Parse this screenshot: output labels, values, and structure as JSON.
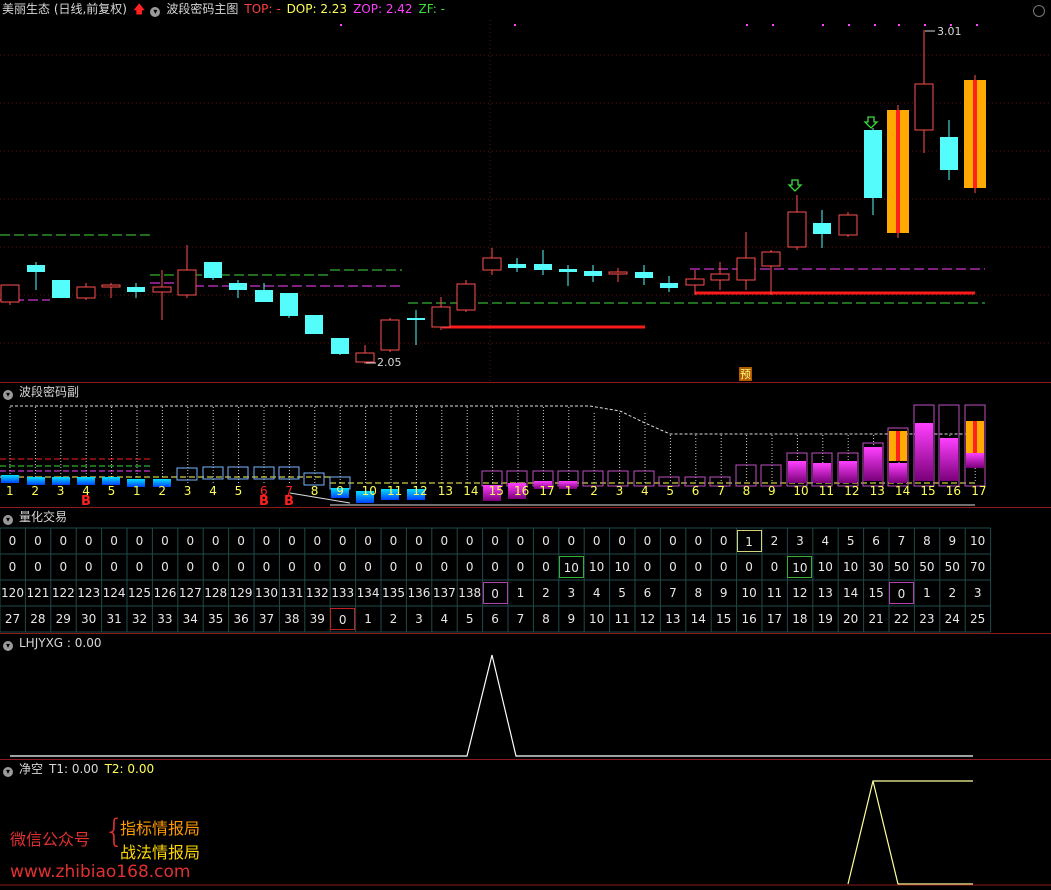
{
  "main": {
    "stock": "美丽生态 (日线,前复权)",
    "indicator": "波段密码主图",
    "top_label": "TOP: -",
    "dop_label": "DOP: 2.23",
    "zop_label": "ZOP: 2.42",
    "zf_label": "ZF: -",
    "high_label": "3.01",
    "low_label": "2.05",
    "yu_badge": "预",
    "colors": {
      "up": "#ff5050",
      "down": "#54fcfc",
      "pink": "#ff40ff",
      "green": "#3cdc3c"
    }
  },
  "sub1": {
    "title": "波段密码副",
    "count_labels": [
      "1",
      "2",
      "3",
      "4",
      "5",
      "1",
      "2",
      "3",
      "4",
      "5",
      "6",
      "7",
      "8",
      "9",
      "10",
      "11",
      "12",
      "13",
      "14",
      "15",
      "16",
      "17",
      "1",
      "2",
      "3",
      "4",
      "5",
      "6",
      "7",
      "8",
      "9",
      "10",
      "11",
      "12",
      "13",
      "14",
      "15",
      "16",
      "17"
    ],
    "b_markers": [
      "B",
      "B",
      "B"
    ]
  },
  "quant": {
    "title": "量化交易",
    "rows": [
      [
        "0",
        "0",
        "0",
        "0",
        "0",
        "0",
        "0",
        "0",
        "0",
        "0",
        "0",
        "0",
        "0",
        "0",
        "0",
        "0",
        "0",
        "0",
        "0",
        "0",
        "0",
        "0",
        "0",
        "0",
        "0",
        "0",
        "0",
        "0",
        "0",
        "1",
        "2",
        "3",
        "4",
        "5",
        "6",
        "7",
        "8",
        "9",
        "10"
      ],
      [
        "0",
        "0",
        "0",
        "0",
        "0",
        "0",
        "0",
        "0",
        "0",
        "0",
        "0",
        "0",
        "0",
        "0",
        "0",
        "0",
        "0",
        "0",
        "0",
        "0",
        "0",
        "0",
        "10",
        "10",
        "10",
        "0",
        "0",
        "0",
        "0",
        "0",
        "0",
        "10",
        "10",
        "10",
        "30",
        "50",
        "50",
        "50",
        "70"
      ],
      [
        "120",
        "121",
        "122",
        "123",
        "124",
        "125",
        "126",
        "127",
        "128",
        "129",
        "130",
        "131",
        "132",
        "133",
        "134",
        "135",
        "136",
        "137",
        "138",
        "0",
        "1",
        "2",
        "3",
        "4",
        "5",
        "6",
        "7",
        "8",
        "9",
        "10",
        "11",
        "12",
        "13",
        "14",
        "15",
        "0",
        "1",
        "2",
        "3"
      ],
      [
        "27",
        "28",
        "29",
        "30",
        "31",
        "32",
        "33",
        "34",
        "35",
        "36",
        "37",
        "38",
        "39",
        "0",
        "1",
        "2",
        "3",
        "4",
        "5",
        "6",
        "7",
        "8",
        "9",
        "10",
        "11",
        "12",
        "13",
        "14",
        "15",
        "16",
        "17",
        "18",
        "19",
        "20",
        "21",
        "22",
        "23",
        "24",
        "25"
      ]
    ]
  },
  "lhjyxg": {
    "title": "LHJYXG : 0.00"
  },
  "jingkong": {
    "title": "净空",
    "t1": "T1: 0.00",
    "t2": "T2: 0.00"
  },
  "watermark": {
    "left": "微信公众号",
    "line1": "指标情报局",
    "line2": "战法情报局",
    "url": "www.zhibiao168.com"
  }
}
